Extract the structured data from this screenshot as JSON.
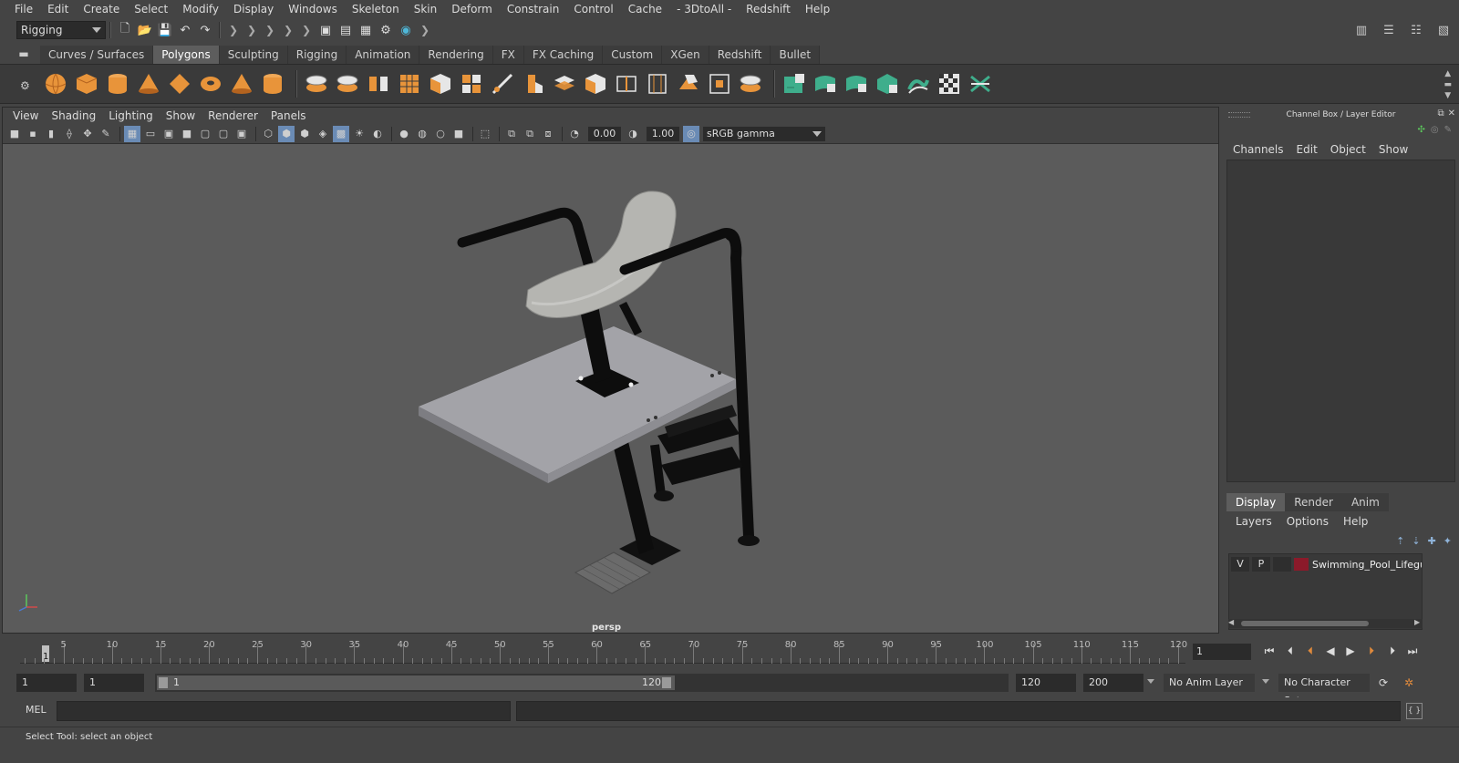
{
  "menubar": {
    "items": [
      "File",
      "Edit",
      "Create",
      "Select",
      "Modify",
      "Display",
      "Windows",
      "Skeleton",
      "Skin",
      "Deform",
      "Constrain",
      "Control",
      "Cache",
      "- 3DtoAll -",
      "Redshift",
      "Help"
    ]
  },
  "statusline": {
    "mode": "Rigging"
  },
  "shelf": {
    "tabs": [
      "Curves / Surfaces",
      "Polygons",
      "Sculpting",
      "Rigging",
      "Animation",
      "Rendering",
      "FX",
      "FX Caching",
      "Custom",
      "XGen",
      "Redshift",
      "Bullet"
    ],
    "active_tab": "Polygons"
  },
  "viewport": {
    "menu": [
      "View",
      "Shading",
      "Lighting",
      "Show",
      "Renderer",
      "Panels"
    ],
    "exposure": "0.00",
    "gamma": "1.00",
    "color_space": "sRGB gamma",
    "camera": "persp"
  },
  "channelbox": {
    "title": "Channel Box / Layer Editor",
    "menu": [
      "Channels",
      "Edit",
      "Object",
      "Show"
    ]
  },
  "layereditor": {
    "tabs": [
      "Display",
      "Render",
      "Anim"
    ],
    "active_tab": "Display",
    "menu": [
      "Layers",
      "Options",
      "Help"
    ],
    "layer": {
      "visible": "V",
      "playback": "P",
      "name": "Swimming_Pool_Lifegua",
      "color": "#8b1a2a"
    }
  },
  "timeslider": {
    "current_frame": "1",
    "tick_labels": [
      "5",
      "10",
      "15",
      "20",
      "25",
      "30",
      "35",
      "40",
      "45",
      "50",
      "55",
      "60",
      "65",
      "70",
      "75",
      "80",
      "85",
      "90",
      "95",
      "100",
      "105",
      "110",
      "115",
      "120"
    ],
    "frame_field": "1"
  },
  "rangeslider": {
    "start": "1",
    "anim_start": "1",
    "range_start_label": "1",
    "range_end_label": "120",
    "range_end": "120",
    "anim_end": "200",
    "anim_layer": "No Anim Layer",
    "character_set": "No Character Set"
  },
  "cmdline": {
    "label": "MEL"
  },
  "helpline": {
    "text": "Select Tool: select an object"
  }
}
